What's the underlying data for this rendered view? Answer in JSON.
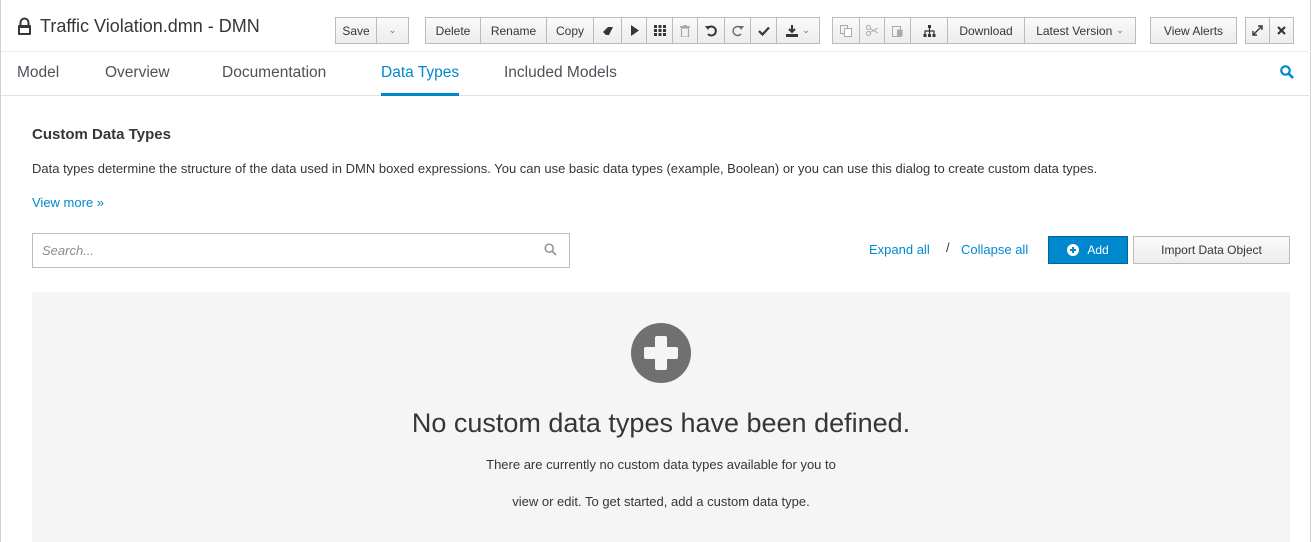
{
  "window": {
    "title": "Traffic Violation.dmn - DMN",
    "icons": {
      "lock": "lock-icon"
    }
  },
  "toolbar": {
    "save_label": "Save",
    "delete_label": "Delete",
    "rename_label": "Rename",
    "copy_label": "Copy",
    "download_label": "Download",
    "latest_version_label": "Latest Version",
    "view_alerts_label": "View Alerts",
    "icons": [
      "eraser-icon",
      "play-icon",
      "grid-icon",
      "trash-icon",
      "undo-icon",
      "redo-icon",
      "check-icon",
      "deploy-icon",
      "copy-icon",
      "cut-icon",
      "paste-icon",
      "hierarchy-icon",
      "expand-icon",
      "close-icon"
    ]
  },
  "tabs": [
    {
      "label": "Model",
      "active": false
    },
    {
      "label": "Overview",
      "active": false
    },
    {
      "label": "Documentation",
      "active": false
    },
    {
      "label": "Data Types",
      "active": true
    },
    {
      "label": "Included Models",
      "active": false
    }
  ],
  "content": {
    "heading": "Custom Data Types",
    "description": "Data types determine the structure of the data used in DMN boxed expressions. You can use basic data types (example, Boolean) or you can use this dialog to create custom data types.",
    "view_more": "View more »",
    "search": {
      "placeholder": "Search...",
      "value": ""
    },
    "expand_all": "Expand all",
    "separator": "/",
    "collapse_all": "Collapse all",
    "add_label": "Add",
    "import_label": "Import Data Object"
  },
  "empty_state": {
    "title": "No custom data types have been defined.",
    "line1": "There are currently no custom data types available for you to",
    "line2": "view or edit. To get started, add a custom data type."
  },
  "colors": {
    "accent": "#0088ce",
    "text": "#363636",
    "empty_bg": "#f5f5f5",
    "icon_gray": "#6a6a6a"
  }
}
